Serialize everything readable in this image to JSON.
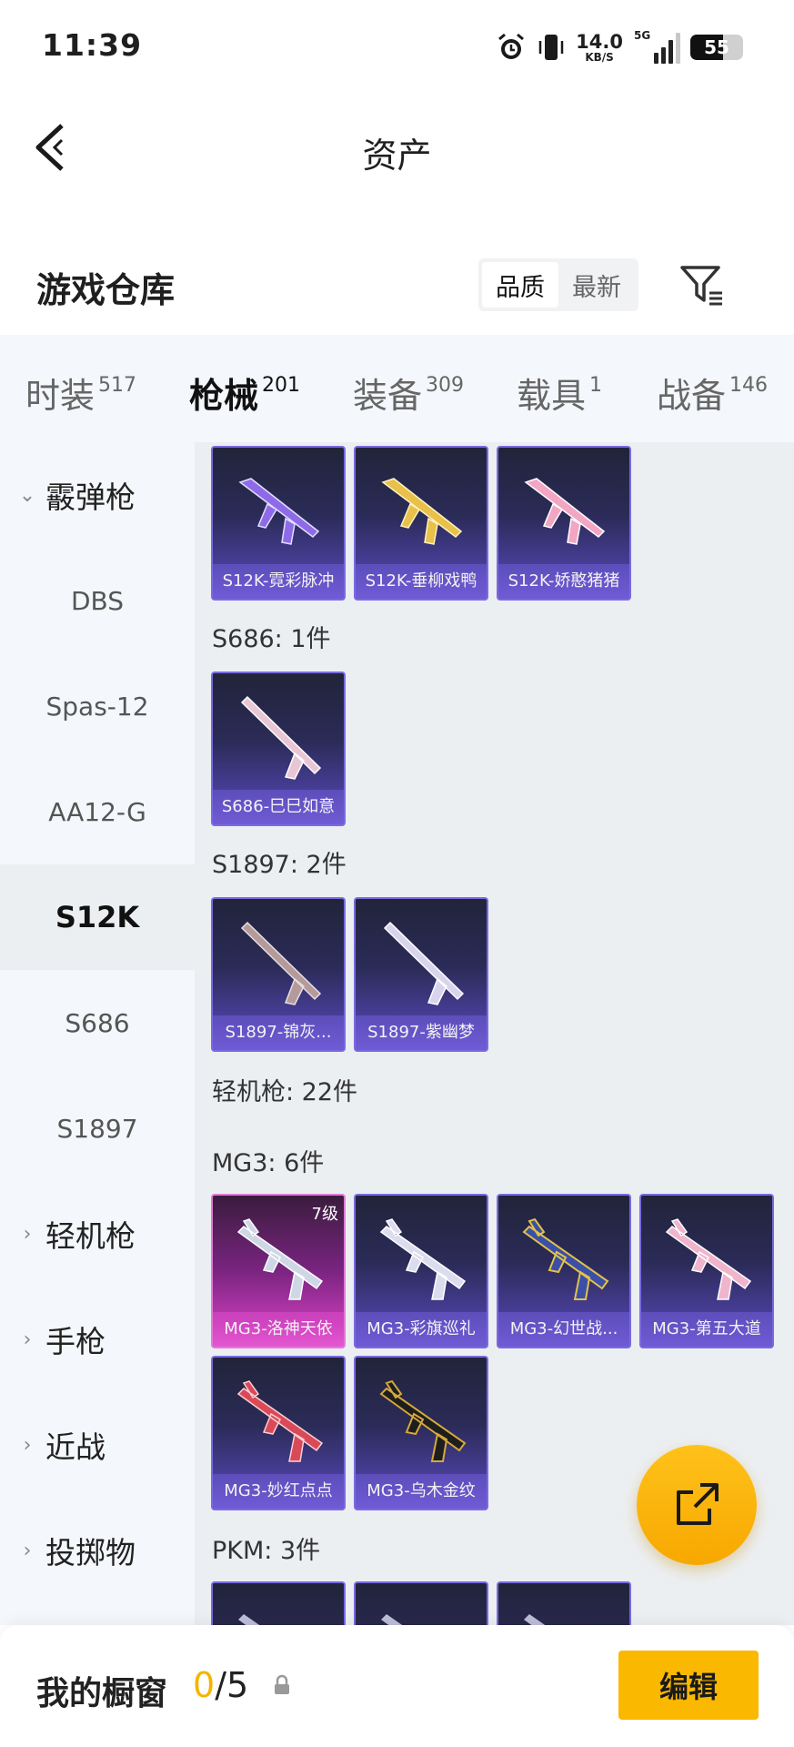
{
  "status_bar": {
    "time": "11:39",
    "net_speed": "14.0",
    "net_unit": "KB/S",
    "signal_label": "5G",
    "battery": "55"
  },
  "header": {
    "title": "资产"
  },
  "vault": {
    "title": "游戏仓库",
    "sort_options": [
      "品质",
      "最新"
    ],
    "sort_selected": "品质"
  },
  "tabs": [
    {
      "label": "时装",
      "count": "517"
    },
    {
      "label": "枪械",
      "count": "201"
    },
    {
      "label": "装备",
      "count": "309"
    },
    {
      "label": "载具",
      "count": "1"
    },
    {
      "label": "战备",
      "count": "146"
    }
  ],
  "active_tab": "枪械",
  "sidebar": {
    "group_shotgun": "霰弹枪",
    "subs": [
      "DBS",
      "Spas-12",
      "AA12-G",
      "S12K",
      "S686",
      "S1897"
    ],
    "active_sub": "S12K",
    "group_lmg": "轻机枪",
    "group_pistol": "手枪",
    "group_melee": "近战",
    "group_throw": "投掷物"
  },
  "content": {
    "s12k_cards": [
      "S12K-霓彩脉冲",
      "S12K-垂柳戏鸭",
      "S12K-娇憨猪猪"
    ],
    "s686_header": "S686: 1件",
    "s686_cards": [
      "S686-巳巳如意"
    ],
    "s1897_header": "S1897: 2件",
    "s1897_cards": [
      "S1897-锦灰...",
      "S1897-紫幽梦"
    ],
    "lmg_header": "轻机枪: 22件",
    "mg3_header": "MG3: 6件",
    "mg3_cards": [
      "MG3-洛神天依",
      "MG3-彩旗巡礼",
      "MG3-幻世战...",
      "MG3-第五大道",
      "MG3-妙红点点",
      "MG3-乌木金纹"
    ],
    "mg3_level": "7级",
    "pkm_header": "PKM: 3件"
  },
  "bottom": {
    "label": "我的橱窗",
    "count_current": "0",
    "count_total": "/5",
    "edit_label": "编辑"
  },
  "colors": {
    "accent": "#f6b000",
    "sidebar_bg": "#f4f7fb",
    "content_bg": "#eceff2"
  }
}
